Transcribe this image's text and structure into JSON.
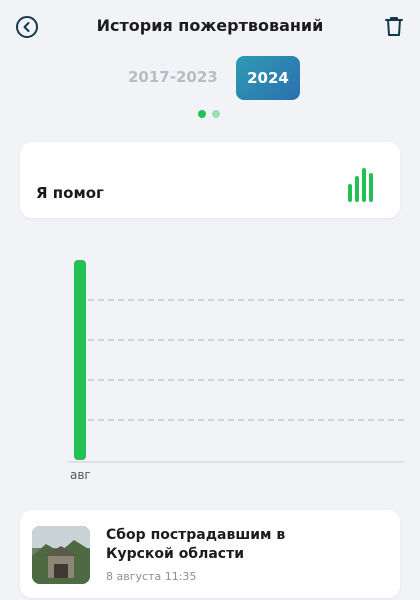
{
  "header": {
    "title": "История пожертвований",
    "back_icon": "back-arrow-icon",
    "trash_icon": "trash-icon"
  },
  "tabs": {
    "inactive_label": "2017-2023",
    "active_label": "2024",
    "active_gradient_start": "#2f9bb3",
    "active_gradient_end": "#2b6fb0"
  },
  "pager": {
    "total": 2,
    "current": 1
  },
  "summary_card": {
    "label": "Я помог",
    "icon": "bar-chart-icon"
  },
  "chart_data": {
    "type": "bar",
    "categories": [
      "авг"
    ],
    "values": [
      1
    ],
    "ylim": [
      0,
      1
    ],
    "grid": true,
    "bar_color": "#23c154"
  },
  "news": {
    "title": "Сбор пострадавшим в Курской области",
    "date": "8 августа 11:35"
  },
  "colors": {
    "accent_green": "#23c154",
    "background": "#f2f3f6"
  }
}
